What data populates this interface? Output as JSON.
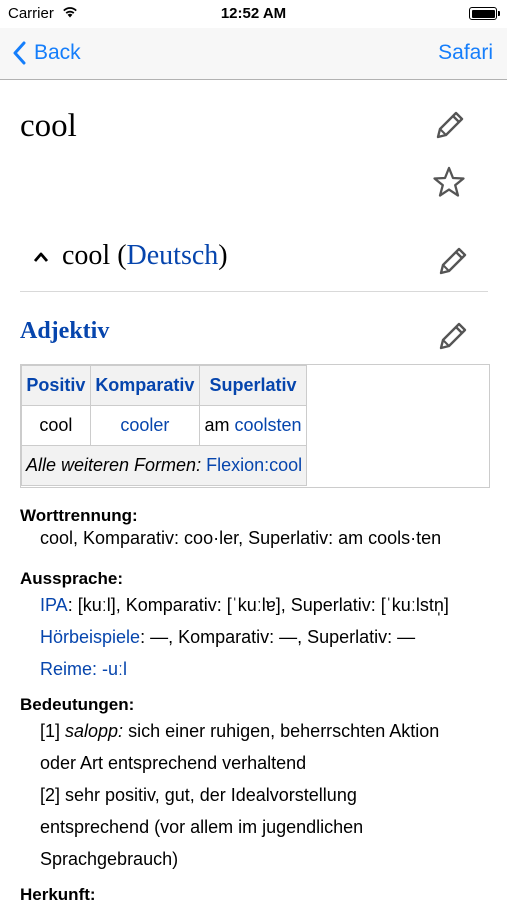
{
  "status": {
    "carrier": "Carrier",
    "time": "12:52 AM"
  },
  "nav": {
    "back_label": "Back",
    "right_label": "Safari"
  },
  "page": {
    "title": "cool"
  },
  "section": {
    "word": "cool (",
    "lang": "Deutsch",
    "close": ")"
  },
  "pos": {
    "label": "Adjektiv"
  },
  "table": {
    "headers": [
      "Positiv",
      "Komparativ",
      "Superlativ"
    ],
    "row": [
      "cool",
      "cooler",
      "am ",
      "coolsten"
    ],
    "foot_label": "Alle weiteren Formen: ",
    "foot_link": "Flexion:cool"
  },
  "worttrennung": {
    "heading": "Worttrennung:",
    "text": "cool, Komparativ: coo·ler, Superlativ: am cools·ten"
  },
  "aussprache": {
    "heading": "Aussprache:",
    "ipa_link": "IPA",
    "ipa_text": ": [kuːl], Komparativ: [ˈkuːlɐ], Superlativ: [ˈkuːlstn̩]",
    "hoer_link": "Hörbeispiele",
    "hoer_text": ": —, Komparativ: —, Superlativ: —",
    "reime_link": "Reime: -uːl"
  },
  "bedeutungen": {
    "heading": "Bedeutungen:",
    "l1a": "[1] ",
    "l1b": "salopp:",
    "l1c": " sich einer ruhigen, beherrschten Aktion",
    "l2": "oder Art entsprechend verhaltend",
    "l3": "[2] sehr positiv, gut, der Idealvorstellung",
    "l4": "entsprechend (vor allem im jugendlichen",
    "l5": "Sprachgebrauch)"
  },
  "herkunft": {
    "heading": "Herkunft:"
  },
  "colors": {
    "accent": "#157efb",
    "link": "#0645ad"
  }
}
